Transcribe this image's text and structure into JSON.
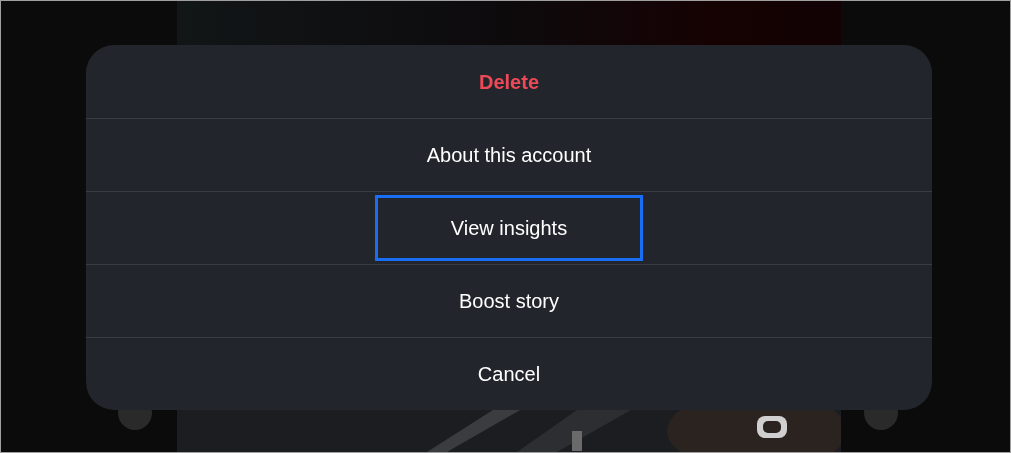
{
  "action_sheet": {
    "items": [
      {
        "label": "Delete",
        "kind": "destructive",
        "highlighted": false
      },
      {
        "label": "About this account",
        "kind": "default",
        "highlighted": false
      },
      {
        "label": "View insights",
        "kind": "default",
        "highlighted": true
      },
      {
        "label": "Boost story",
        "kind": "default",
        "highlighted": false
      },
      {
        "label": "Cancel",
        "kind": "default",
        "highlighted": false
      }
    ]
  }
}
